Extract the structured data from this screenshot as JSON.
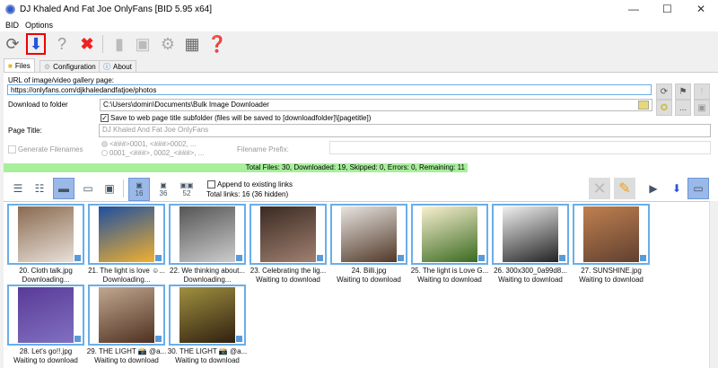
{
  "window": {
    "title": "DJ Khaled And Fat Joe OnlyFans [BID 5.95 x64]",
    "minimize": "—",
    "maximize": "☐",
    "close": "✕"
  },
  "menu": [
    "BID",
    "Options"
  ],
  "tabs": [
    "Files",
    "Configuration",
    "About"
  ],
  "form": {
    "url_label": "URL of image/video gallery page:",
    "url_value": "https://onlyfans.com/djkhaledandfatjoe/photos",
    "folder_label": "Download to folder",
    "folder_value": "C:\\Users\\domin\\Documents\\Bulk Image Downloader",
    "subfolder_label": "Save to web page title subfolder (files will be saved to [downloadfolder]\\[pagetitle])",
    "subfolder_checked": true,
    "page_title_label": "Page Title:",
    "page_title_value": "DJ Khaled And Fat Joe OnlyFans",
    "generate_label": "Generate Filenames",
    "pattern1": "<###>0001, <###>0002, ...",
    "pattern2": "0001_<###>, 0002_<###>, ...",
    "prefix_label": "Filename Prefix:",
    "browse_label": "..."
  },
  "status": "Total Files: 30, Downloaded: 19, Skipped: 0, Errors: 0, Remaining: 11",
  "view": {
    "size_options": [
      "16",
      "36",
      "52"
    ],
    "append_label": "Append to existing links",
    "total_links": "Total links: 16 (36 hidden)"
  },
  "items": [
    {
      "name": "20. Cloth talk.jpg",
      "status": "Downloading...",
      "c1": "#8a6a50",
      "c2": "#e8e0d8"
    },
    {
      "name": "21. The light is love ☺...",
      "status": "Downloading...",
      "c1": "#1e4fa0",
      "c2": "#f0b030"
    },
    {
      "name": "22. We thinking about...",
      "status": "Downloading...",
      "c1": "#555",
      "c2": "#ccc"
    },
    {
      "name": "23. Celebrating the lig...",
      "status": "Waiting to download",
      "c1": "#3a2a22",
      "c2": "#a08070"
    },
    {
      "name": "24. Billi.jpg",
      "status": "Waiting to download",
      "c1": "#e8e4e0",
      "c2": "#503828"
    },
    {
      "name": "25. The light is Love G...",
      "status": "Waiting to download",
      "c1": "#f8f0d0",
      "c2": "#3a6a20"
    },
    {
      "name": "26. 300x300_0a99d8...",
      "status": "Waiting to download",
      "c1": "#f0f0f0",
      "c2": "#222"
    },
    {
      "name": "27. SUNSHINE.jpg",
      "status": "Waiting to download",
      "c1": "#c08050",
      "c2": "#604030"
    },
    {
      "name": "28. Let's go!!.jpg",
      "status": "Waiting to download",
      "c1": "#5a3a98",
      "c2": "#8070c0"
    },
    {
      "name": "29. THE LIGHT 📸 @a...",
      "status": "Waiting to download",
      "c1": "#c0a890",
      "c2": "#503020"
    },
    {
      "name": "30. THE LIGHT 📸 @a...",
      "status": "Waiting to download",
      "c1": "#a09040",
      "c2": "#302010"
    }
  ]
}
